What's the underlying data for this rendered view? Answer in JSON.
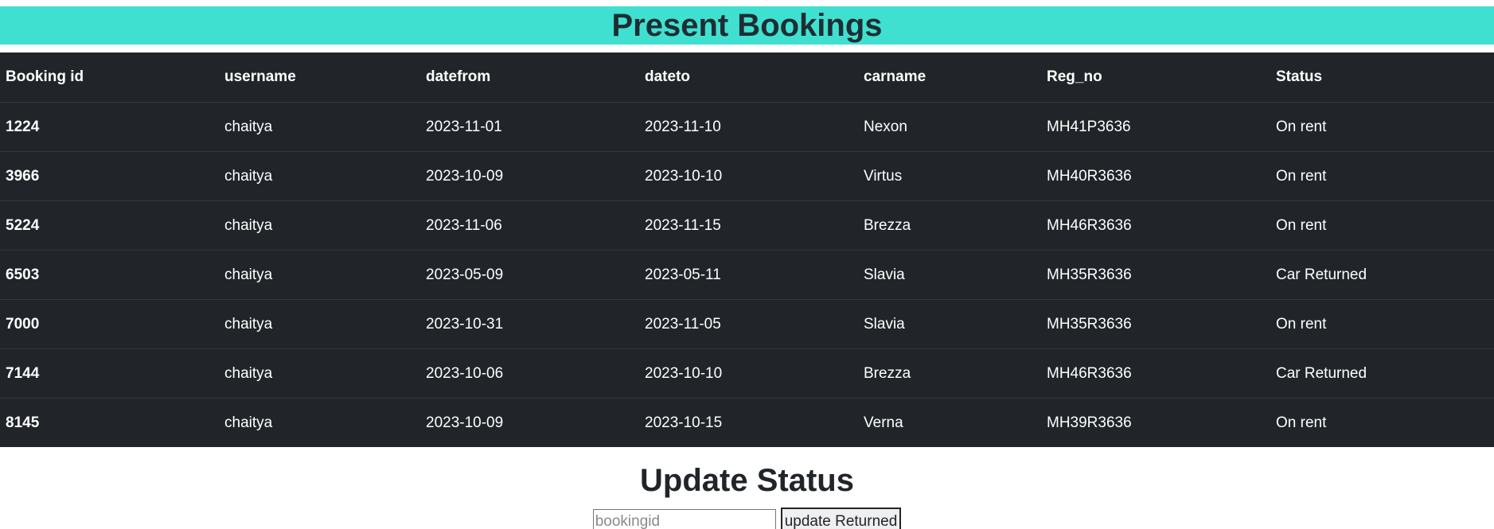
{
  "header": {
    "title": "Present Bookings"
  },
  "table": {
    "columns": [
      "Booking id",
      "username",
      "datefrom",
      "dateto",
      "carname",
      "Reg_no",
      "Status"
    ],
    "rows": [
      [
        "1224",
        "chaitya",
        "2023-11-01",
        "2023-11-10",
        "Nexon",
        "MH41P3636",
        "On rent"
      ],
      [
        "3966",
        "chaitya",
        "2023-10-09",
        "2023-10-10",
        "Virtus",
        "MH40R3636",
        "On rent"
      ],
      [
        "5224",
        "chaitya",
        "2023-11-06",
        "2023-11-15",
        "Brezza",
        "MH46R3636",
        "On rent"
      ],
      [
        "6503",
        "chaitya",
        "2023-05-09",
        "2023-05-11",
        "Slavia",
        "MH35R3636",
        "Car Returned"
      ],
      [
        "7000",
        "chaitya",
        "2023-10-31",
        "2023-11-05",
        "Slavia",
        "MH35R3636",
        "On rent"
      ],
      [
        "7144",
        "chaitya",
        "2023-10-06",
        "2023-10-10",
        "Brezza",
        "MH46R3636",
        "Car Returned"
      ],
      [
        "8145",
        "chaitya",
        "2023-10-09",
        "2023-10-15",
        "Verna",
        "MH39R3636",
        "On rent"
      ]
    ]
  },
  "update": {
    "title": "Update Status",
    "input_value": "",
    "input_placeholder": "bookingid",
    "button_label": "update Returned"
  },
  "colors": {
    "header_bg": "#40e0d0",
    "table_bg": "#212529",
    "table_text": "#ffffff"
  }
}
